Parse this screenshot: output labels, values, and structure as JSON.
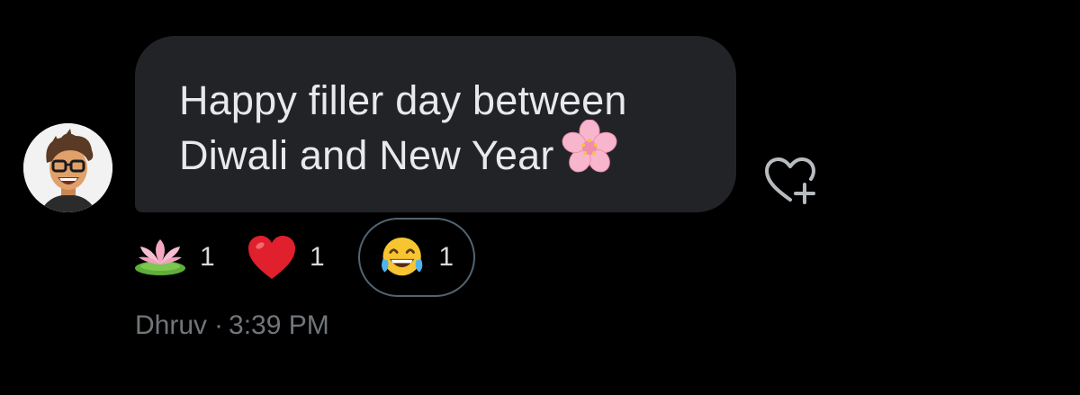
{
  "message": {
    "text_line1": "Happy filler day between",
    "text_line2": "Diwali and New Year",
    "text_emoji": "cherry-blossom-icon"
  },
  "sender": {
    "name": "Dhruv",
    "separator": "·",
    "time": "3:39 PM",
    "avatar_icon": "cartoon-avatar-with-glasses"
  },
  "reactions": [
    {
      "icon": "lotus-icon",
      "count": "1",
      "selected": false
    },
    {
      "icon": "red-heart-icon",
      "count": "1",
      "selected": false
    },
    {
      "icon": "tears-of-joy-icon",
      "count": "1",
      "selected": true
    }
  ],
  "actions": {
    "add_reaction_icon": "heart-plus-icon"
  },
  "colors": {
    "background": "#000000",
    "bubble": "#212327",
    "text": "#e7e9ea",
    "meta": "#71767b",
    "selected_border": "#536471"
  }
}
